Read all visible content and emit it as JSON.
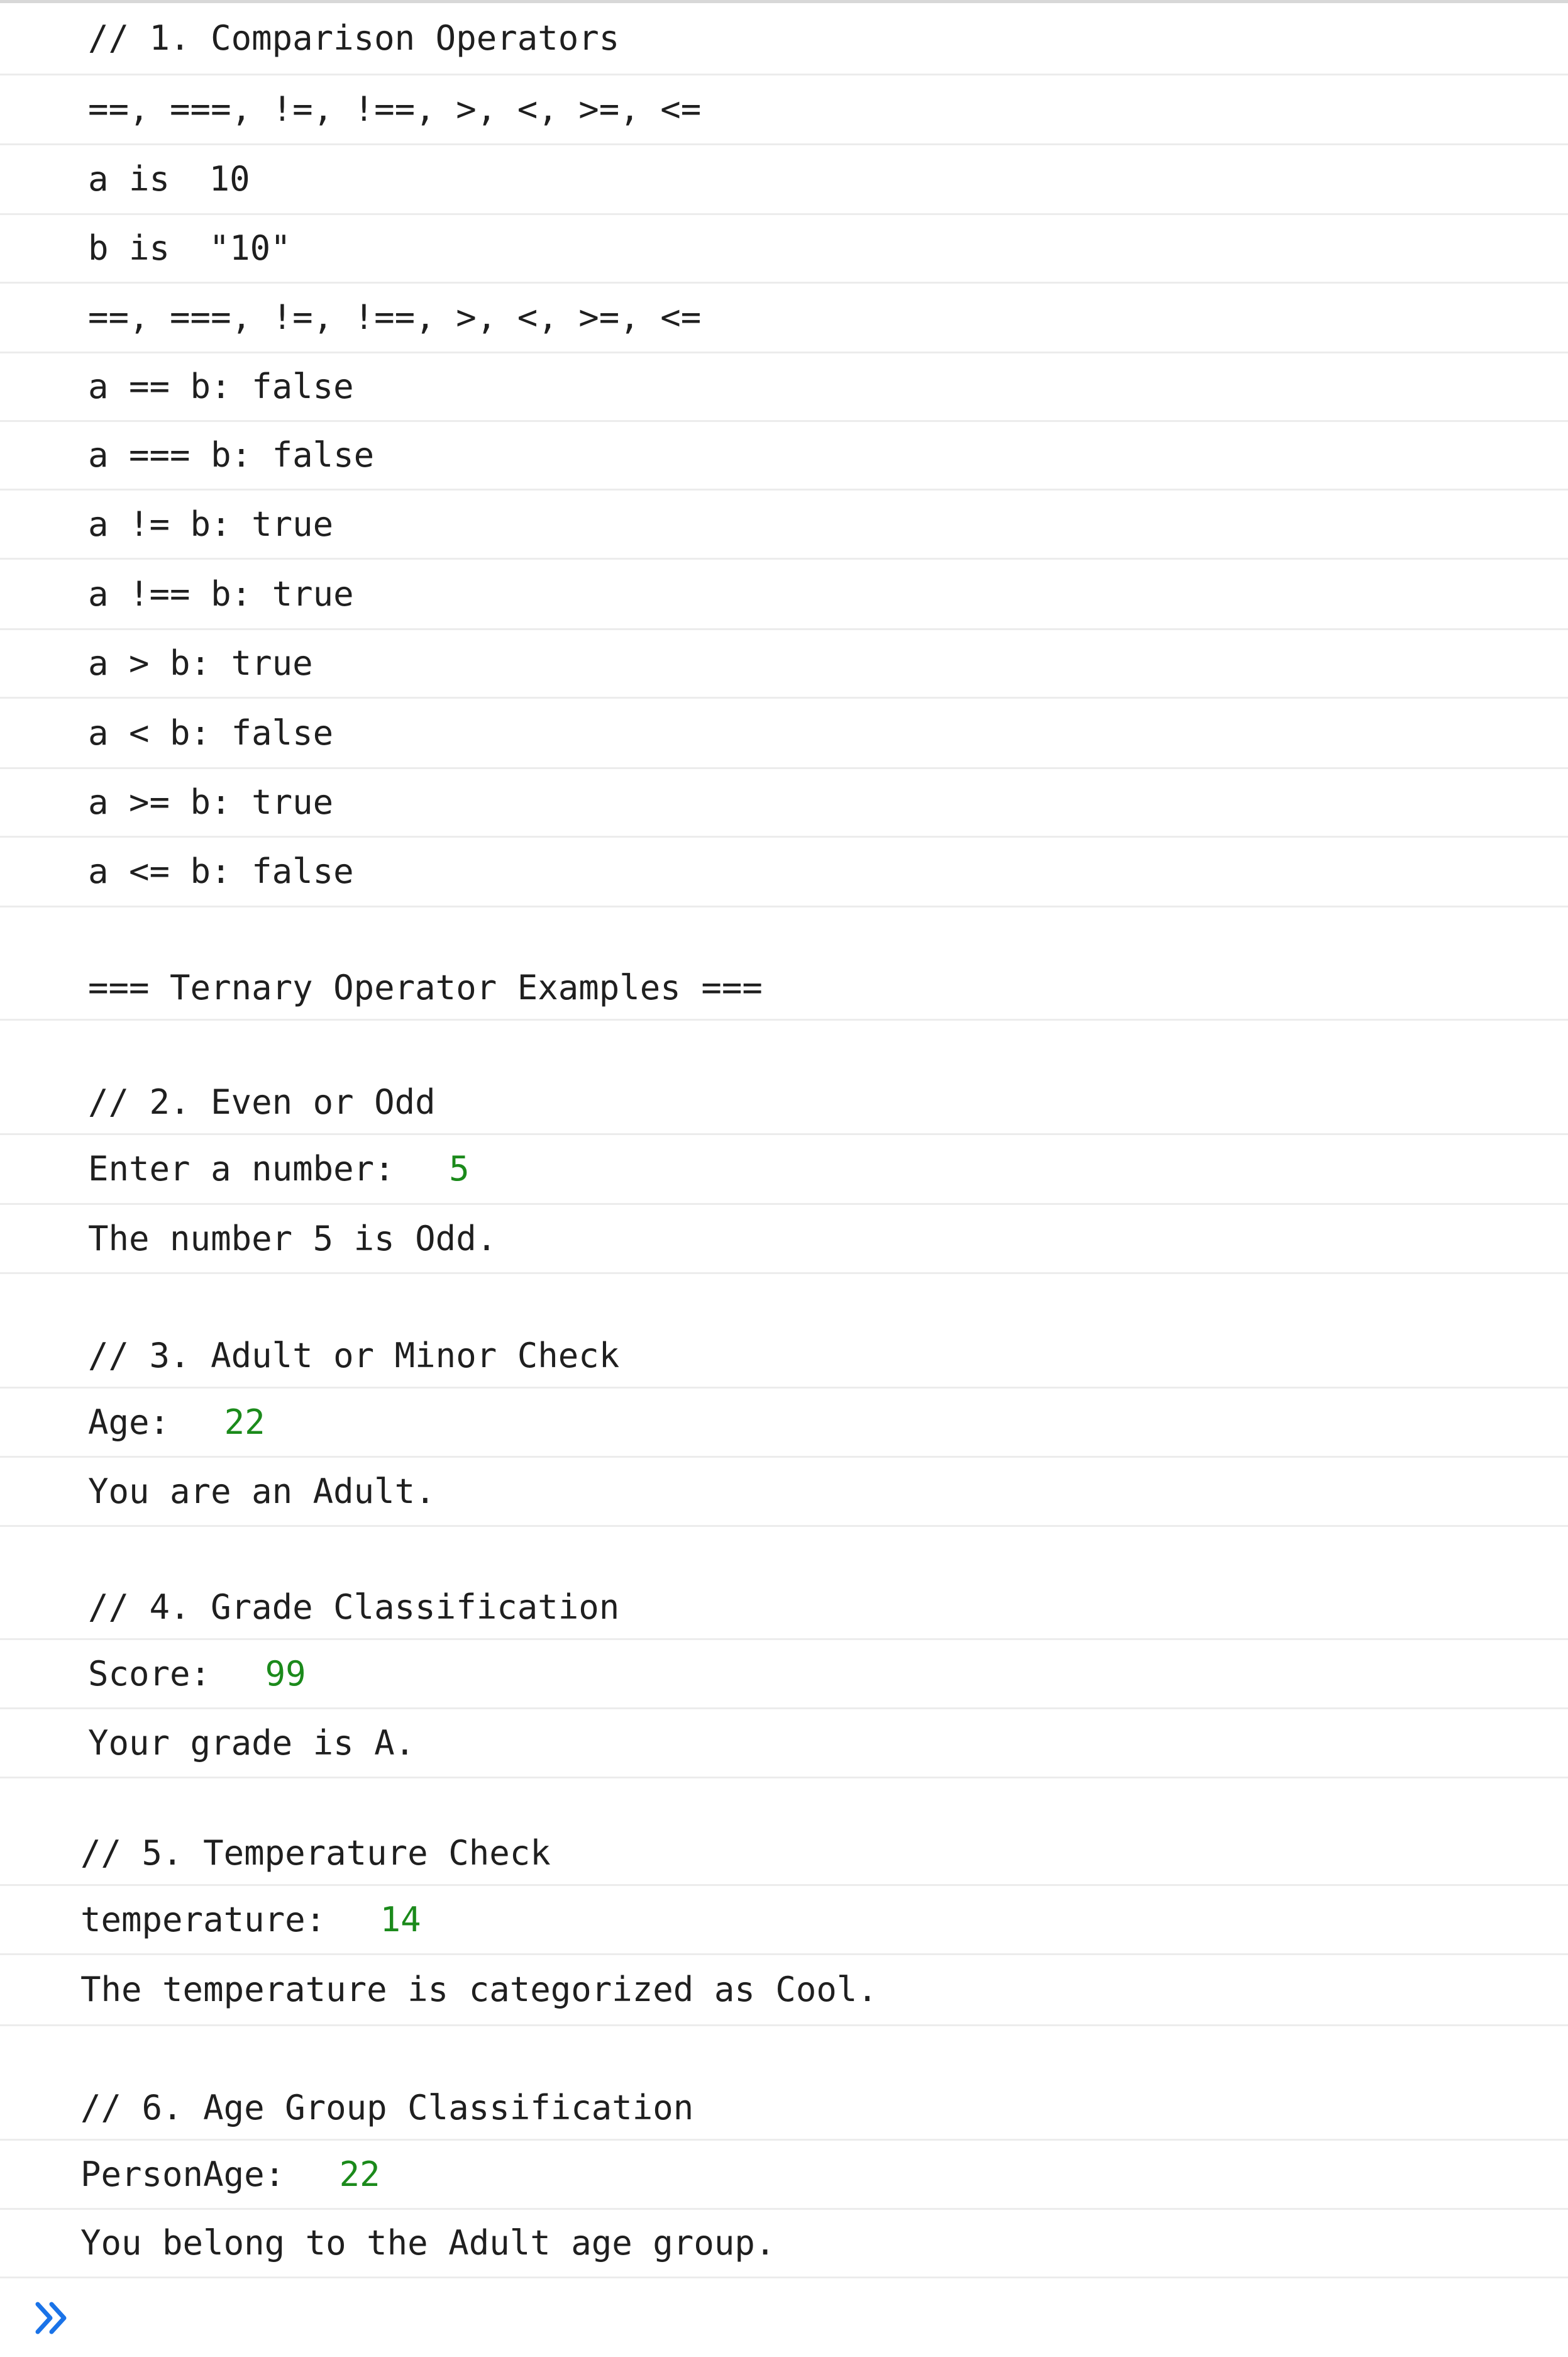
{
  "console": {
    "rows": [
      {
        "text": "// 1. Comparison Operators"
      },
      {
        "text": "==, ===, !=, !==, >, <, >=, <="
      },
      {
        "text": "a is ",
        "value": "10"
      },
      {
        "text": "b is ",
        "value": "\"10\"",
        "value_plain": true
      },
      {
        "text": "==, ===, !=, !==, >, <, >=, <="
      },
      {
        "text": "a == b: false"
      },
      {
        "text": "a === b: false"
      },
      {
        "text": "a != b: true"
      },
      {
        "text": "a !== b: true"
      },
      {
        "text": "a > b: true"
      },
      {
        "text": "a < b: false"
      },
      {
        "text": "a >= b: true"
      },
      {
        "text": "a <= b: false"
      },
      {
        "text": "\n=== Ternary Operator Examples ==="
      },
      {
        "text": "\n// 2. Even or Odd"
      },
      {
        "text": "Enter a number: ",
        "value": "5"
      },
      {
        "text": "The number 5 is Odd."
      },
      {
        "text": "\n// 3. Adult or Minor Check"
      },
      {
        "text": "Age: ",
        "value": "22"
      },
      {
        "text": "You are an Adult."
      },
      {
        "text": "\n// 4. Grade Classification"
      },
      {
        "text": "Score: ",
        "value": "99"
      },
      {
        "text": "Your grade is A."
      },
      {
        "text": "\n// 5. Temperature Check"
      },
      {
        "text": "temperature: ",
        "value": "14"
      },
      {
        "text": "The temperature is categorized as Cool."
      },
      {
        "text": "\n// 6. Age Group Classification"
      },
      {
        "text": "PersonAge: ",
        "value": "22"
      },
      {
        "text": "You belong to the Adult age group."
      }
    ],
    "prompt_icon": "chevron-double-right-icon"
  },
  "colors": {
    "text": "#1f1f1f",
    "value": "#1b8a1b",
    "divider": "#ececec",
    "prompt": "#1a73e8"
  }
}
